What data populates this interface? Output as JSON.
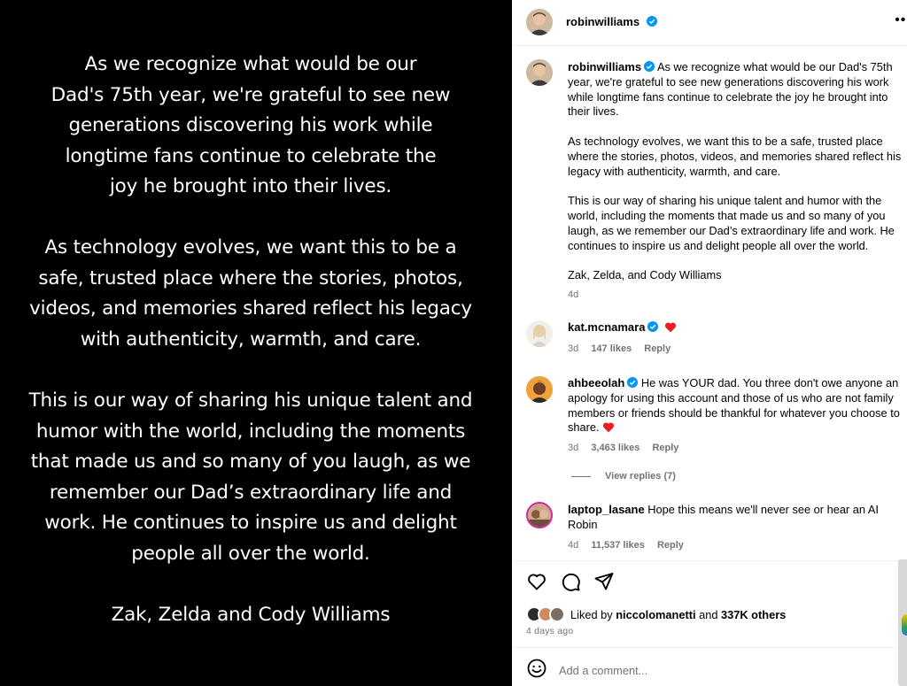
{
  "image_text": {
    "paragraph1": [
      "As we recognize what would be our",
      "Dad's 75th year, we're grateful to see new",
      "generations discovering his work while",
      "longtime fans continue to celebrate the",
      "joy he brought into their lives."
    ],
    "paragraph2": [
      "As technology evolves, we want this to be a",
      "safe, trusted place where the stories, photos,",
      "videos, and memories shared reflect his legacy",
      "with authenticity, warmth, and care."
    ],
    "paragraph3": [
      "This is our way of sharing his unique talent and",
      "humor with the world, including the moments",
      "that made us and so many of you laugh, as we",
      "remember our Dad’s extraordinary life and",
      "work. He continues to inspire us and delight",
      "people all over the world."
    ],
    "signature": "Zak, Zelda and Cody Williams"
  },
  "header": {
    "username": "robinwilliams",
    "more_icon": "more-horizontal-icon"
  },
  "caption": {
    "username": "robinwilliams",
    "paragraphs": [
      "As we recognize what would be our Dad's 75th year, we're grateful to see new generations discovering his work while longtime fans continue to celebrate the joy he brought into their lives.",
      "As technology evolves, we want this to be a safe, trusted place where the stories, photos, videos, and memories shared reflect his legacy with authenticity, warmth, and care.",
      "This is our way of sharing his unique talent and humor with the world, including the moments that made us and so many of you laugh, as we remember our Dad’s extraordinary life and work. He continues to inspire us and delight people all over the world.",
      "Zak, Zelda, and Cody Williams"
    ],
    "time": "4d"
  },
  "comments": [
    {
      "username": "kat.mcnamara",
      "verified": true,
      "text": "",
      "emoji": "❤️",
      "time": "3d",
      "likes": "147 likes",
      "reply": "Reply"
    },
    {
      "username": "ahbeeolah",
      "verified": true,
      "text": "He was YOUR dad. You three don't owe anyone an apology for using this account and those of us who are not family members or friends should be thankful for whatever you choose to share.",
      "emoji": "❤️",
      "time": "3d",
      "likes": "3,463 likes",
      "reply": "Reply"
    },
    {
      "username": "laptop_lasane",
      "verified": false,
      "text": "Hope this means we'll never see or hear an AI Robin",
      "time": "4d",
      "likes": "11,537 likes",
      "reply": "Reply"
    }
  ],
  "view_replies": "View replies (7)",
  "likes": {
    "prefix": "Liked by",
    "user": "niccolomanetti",
    "and": "and",
    "others": "337K others"
  },
  "time_ago": "4 days ago",
  "add_comment": {
    "placeholder": "Add a comment..."
  },
  "colors": {
    "verified": "#0095f6",
    "heart": "#ed1c24",
    "muted": "#737373"
  }
}
